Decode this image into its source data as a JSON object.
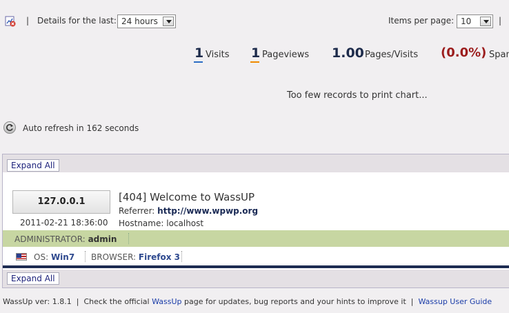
{
  "header": {
    "separator": "|",
    "details_label": "Details for the last:",
    "period_value": "24 hours",
    "items_per_page_label": "Items per page:",
    "items_per_page_value": "10"
  },
  "stats": {
    "visits_value": "1",
    "visits_label": "Visits",
    "pageviews_value": "1",
    "pageviews_label": "Pageviews",
    "pages_per_visit_value": "1.00",
    "pages_per_visit_label": "Pages/Visits",
    "spam_value": "(0.0%)",
    "spam_label": "Spam"
  },
  "chart_message": "Too few records to print chart...",
  "refresh": {
    "prefix": "Auto refresh in",
    "seconds": "162",
    "suffix": "seconds"
  },
  "panel": {
    "expand_label": "Expand All",
    "visit": {
      "ip": "127.0.0.1",
      "date": "2011-02-21 18:36:00",
      "title": "[404] Welcome to WassUP",
      "referrer_label": "Referrer:",
      "referrer_value": "http://www.wpwp.org",
      "hostname_label": "Hostname:",
      "hostname_value": "localhost",
      "user_label": "ADMINISTRATOR:",
      "user_value": "admin",
      "os_label": "OS:",
      "os_value": "Win7",
      "browser_label": "BROWSER:",
      "browser_value": "Firefox 3"
    }
  },
  "footer": {
    "version": "WassUp ver: 1.8.1",
    "sep": "|",
    "check_text": "Check the official",
    "wassup_link": "WassUp",
    "rest_text": "page for updates, bug reports and your hints to improve it",
    "guide_link": "Wassup User Guide"
  },
  "colors": {
    "background": "#f1eff1",
    "admin_row": "#c7d6a2",
    "spam": "#9b1c1c",
    "link": "#1a3ca8"
  }
}
